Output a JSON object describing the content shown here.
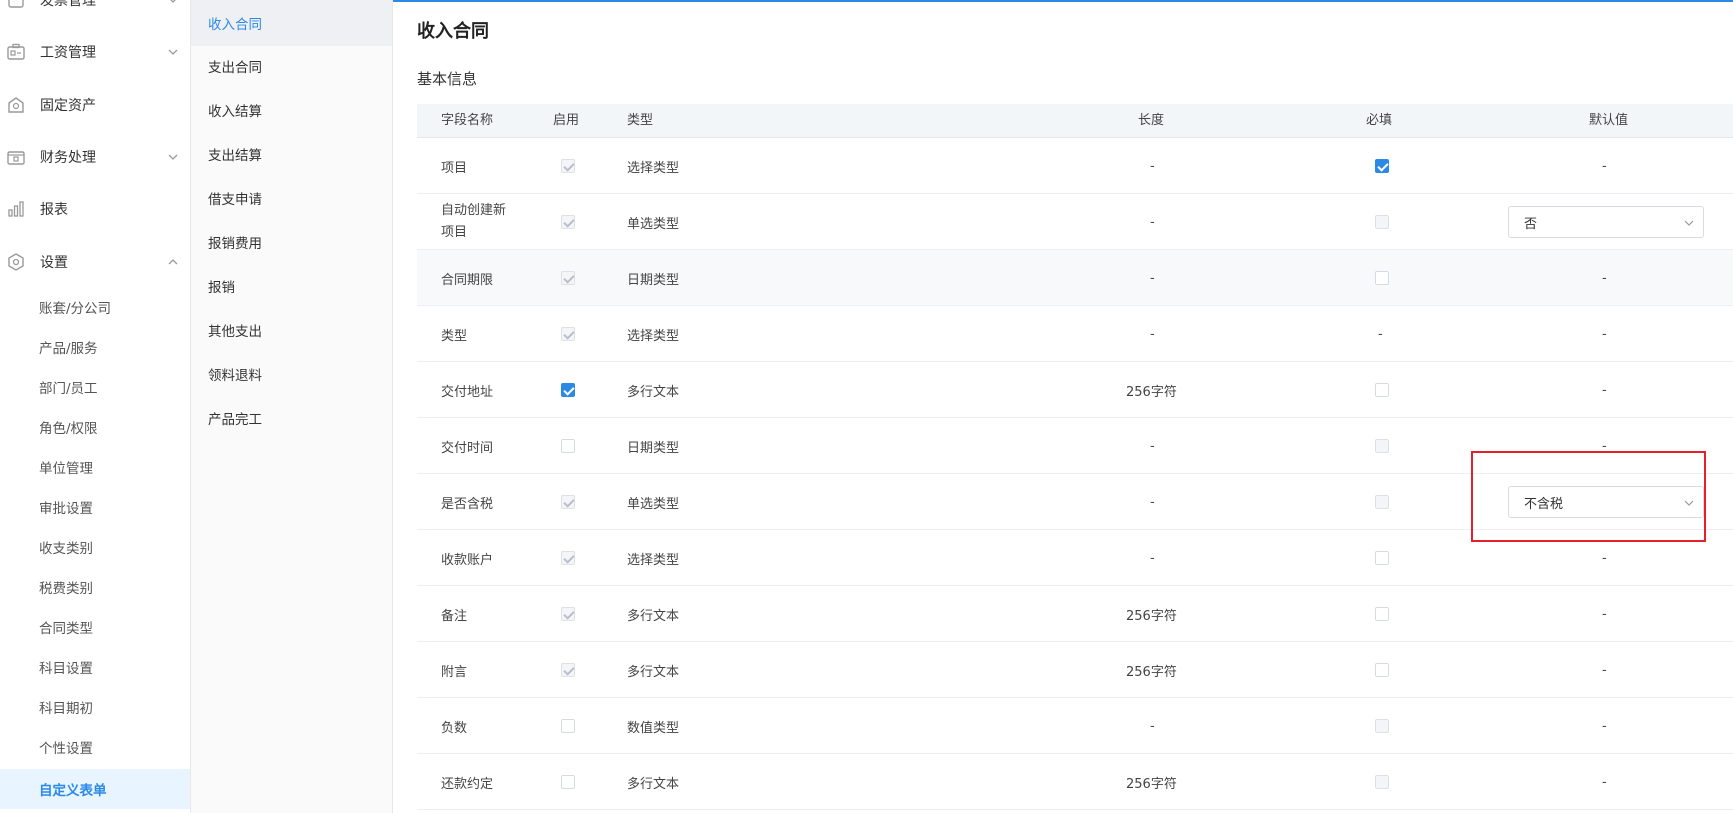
{
  "colors": {
    "accent": "#2b8ae6",
    "highlight": "#e5202c"
  },
  "sidebar": {
    "partial_top_label": "发票管理",
    "items": [
      {
        "label": "工资管理",
        "icon": "payroll-icon",
        "chevron": "down"
      },
      {
        "label": "固定资产",
        "icon": "asset-icon",
        "chevron": ""
      },
      {
        "label": "财务处理",
        "icon": "finance-icon",
        "chevron": "down"
      },
      {
        "label": "报表",
        "icon": "bar-chart-icon",
        "chevron": ""
      },
      {
        "label": "设置",
        "icon": "settings-icon",
        "chevron": "up"
      }
    ],
    "settings_children": [
      "账套/分公司",
      "产品/服务",
      "部门/员工",
      "角色/权限",
      "单位管理",
      "审批设置",
      "收支类别",
      "税费类别",
      "合同类型",
      "科目设置",
      "科目期初",
      "个性设置",
      "自定义表单"
    ],
    "active_child": "自定义表单"
  },
  "subnav": {
    "items": [
      "收入合同",
      "支出合同",
      "收入结算",
      "支出结算",
      "借支申请",
      "报销费用",
      "报销",
      "其他支出",
      "领料退料",
      "产品完工"
    ],
    "active": "收入合同"
  },
  "main": {
    "title": "收入合同",
    "section": "基本信息",
    "columns": [
      "字段名称",
      "启用",
      "类型",
      "长度",
      "必填",
      "默认值"
    ],
    "rows": [
      {
        "name": "项目",
        "enabled": "checked-disabled",
        "type": "选择类型",
        "length": "-",
        "required": "checked",
        "default": "-"
      },
      {
        "name": "自动创建新项目",
        "enabled": "checked-disabled",
        "type": "单选类型",
        "length": "-",
        "required": "unchecked-disabled",
        "default_select": "否"
      },
      {
        "name": "合同期限",
        "enabled": "checked-disabled",
        "type": "日期类型",
        "length": "-",
        "required": "unchecked",
        "default": "-"
      },
      {
        "name": "类型",
        "enabled": "checked-disabled",
        "type": "选择类型",
        "length": "-",
        "required_text": "-",
        "default": "-"
      },
      {
        "name": "交付地址",
        "enabled": "checked",
        "type": "多行文本",
        "length": "256字符",
        "required": "unchecked",
        "default": "-"
      },
      {
        "name": "交付时间",
        "enabled": "unchecked",
        "type": "日期类型",
        "length": "-",
        "required": "unchecked-disabled",
        "default": "-"
      },
      {
        "name": "是否含税",
        "enabled": "checked-disabled",
        "type": "单选类型",
        "length": "-",
        "required": "unchecked-disabled",
        "default_select": "不含税"
      },
      {
        "name": "收款账户",
        "enabled": "checked-disabled",
        "type": "选择类型",
        "length": "-",
        "required": "unchecked",
        "default": "-"
      },
      {
        "name": "备注",
        "enabled": "checked-disabled",
        "type": "多行文本",
        "length": "256字符",
        "required": "unchecked",
        "default": "-"
      },
      {
        "name": "附言",
        "enabled": "checked-disabled",
        "type": "多行文本",
        "length": "256字符",
        "required": "unchecked",
        "default": "-"
      },
      {
        "name": "负数",
        "enabled": "unchecked",
        "type": "数值类型",
        "length": "-",
        "required": "unchecked-disabled",
        "default": "-"
      },
      {
        "name": "还款约定",
        "enabled": "unchecked",
        "type": "多行文本",
        "length": "256字符",
        "required": "unchecked-disabled",
        "default": "-"
      }
    ]
  }
}
